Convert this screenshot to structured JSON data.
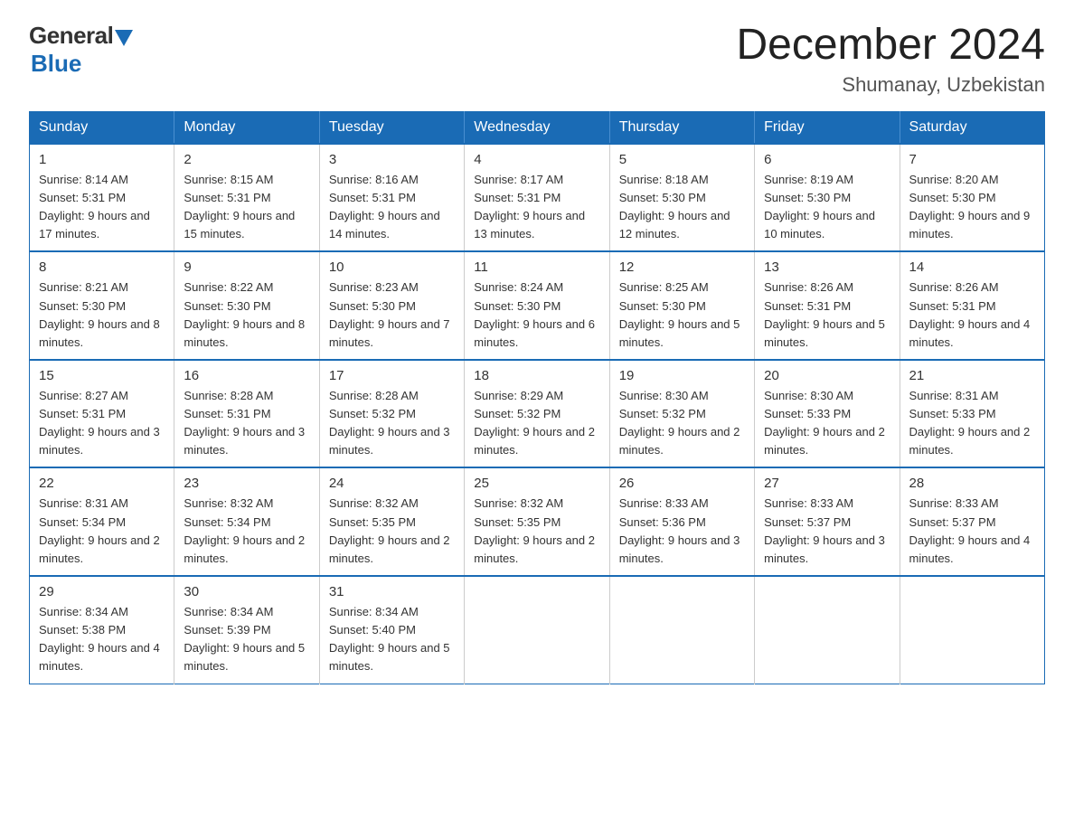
{
  "logo": {
    "text_general": "General",
    "text_blue": "Blue"
  },
  "header": {
    "month_year": "December 2024",
    "location": "Shumanay, Uzbekistan"
  },
  "days_of_week": [
    "Sunday",
    "Monday",
    "Tuesday",
    "Wednesday",
    "Thursday",
    "Friday",
    "Saturday"
  ],
  "weeks": [
    [
      {
        "day": "1",
        "sunrise": "8:14 AM",
        "sunset": "5:31 PM",
        "daylight": "9 hours and 17 minutes."
      },
      {
        "day": "2",
        "sunrise": "8:15 AM",
        "sunset": "5:31 PM",
        "daylight": "9 hours and 15 minutes."
      },
      {
        "day": "3",
        "sunrise": "8:16 AM",
        "sunset": "5:31 PM",
        "daylight": "9 hours and 14 minutes."
      },
      {
        "day": "4",
        "sunrise": "8:17 AM",
        "sunset": "5:31 PM",
        "daylight": "9 hours and 13 minutes."
      },
      {
        "day": "5",
        "sunrise": "8:18 AM",
        "sunset": "5:30 PM",
        "daylight": "9 hours and 12 minutes."
      },
      {
        "day": "6",
        "sunrise": "8:19 AM",
        "sunset": "5:30 PM",
        "daylight": "9 hours and 10 minutes."
      },
      {
        "day": "7",
        "sunrise": "8:20 AM",
        "sunset": "5:30 PM",
        "daylight": "9 hours and 9 minutes."
      }
    ],
    [
      {
        "day": "8",
        "sunrise": "8:21 AM",
        "sunset": "5:30 PM",
        "daylight": "9 hours and 8 minutes."
      },
      {
        "day": "9",
        "sunrise": "8:22 AM",
        "sunset": "5:30 PM",
        "daylight": "9 hours and 8 minutes."
      },
      {
        "day": "10",
        "sunrise": "8:23 AM",
        "sunset": "5:30 PM",
        "daylight": "9 hours and 7 minutes."
      },
      {
        "day": "11",
        "sunrise": "8:24 AM",
        "sunset": "5:30 PM",
        "daylight": "9 hours and 6 minutes."
      },
      {
        "day": "12",
        "sunrise": "8:25 AM",
        "sunset": "5:30 PM",
        "daylight": "9 hours and 5 minutes."
      },
      {
        "day": "13",
        "sunrise": "8:26 AM",
        "sunset": "5:31 PM",
        "daylight": "9 hours and 5 minutes."
      },
      {
        "day": "14",
        "sunrise": "8:26 AM",
        "sunset": "5:31 PM",
        "daylight": "9 hours and 4 minutes."
      }
    ],
    [
      {
        "day": "15",
        "sunrise": "8:27 AM",
        "sunset": "5:31 PM",
        "daylight": "9 hours and 3 minutes."
      },
      {
        "day": "16",
        "sunrise": "8:28 AM",
        "sunset": "5:31 PM",
        "daylight": "9 hours and 3 minutes."
      },
      {
        "day": "17",
        "sunrise": "8:28 AM",
        "sunset": "5:32 PM",
        "daylight": "9 hours and 3 minutes."
      },
      {
        "day": "18",
        "sunrise": "8:29 AM",
        "sunset": "5:32 PM",
        "daylight": "9 hours and 2 minutes."
      },
      {
        "day": "19",
        "sunrise": "8:30 AM",
        "sunset": "5:32 PM",
        "daylight": "9 hours and 2 minutes."
      },
      {
        "day": "20",
        "sunrise": "8:30 AM",
        "sunset": "5:33 PM",
        "daylight": "9 hours and 2 minutes."
      },
      {
        "day": "21",
        "sunrise": "8:31 AM",
        "sunset": "5:33 PM",
        "daylight": "9 hours and 2 minutes."
      }
    ],
    [
      {
        "day": "22",
        "sunrise": "8:31 AM",
        "sunset": "5:34 PM",
        "daylight": "9 hours and 2 minutes."
      },
      {
        "day": "23",
        "sunrise": "8:32 AM",
        "sunset": "5:34 PM",
        "daylight": "9 hours and 2 minutes."
      },
      {
        "day": "24",
        "sunrise": "8:32 AM",
        "sunset": "5:35 PM",
        "daylight": "9 hours and 2 minutes."
      },
      {
        "day": "25",
        "sunrise": "8:32 AM",
        "sunset": "5:35 PM",
        "daylight": "9 hours and 2 minutes."
      },
      {
        "day": "26",
        "sunrise": "8:33 AM",
        "sunset": "5:36 PM",
        "daylight": "9 hours and 3 minutes."
      },
      {
        "day": "27",
        "sunrise": "8:33 AM",
        "sunset": "5:37 PM",
        "daylight": "9 hours and 3 minutes."
      },
      {
        "day": "28",
        "sunrise": "8:33 AM",
        "sunset": "5:37 PM",
        "daylight": "9 hours and 4 minutes."
      }
    ],
    [
      {
        "day": "29",
        "sunrise": "8:34 AM",
        "sunset": "5:38 PM",
        "daylight": "9 hours and 4 minutes."
      },
      {
        "day": "30",
        "sunrise": "8:34 AM",
        "sunset": "5:39 PM",
        "daylight": "9 hours and 5 minutes."
      },
      {
        "day": "31",
        "sunrise": "8:34 AM",
        "sunset": "5:40 PM",
        "daylight": "9 hours and 5 minutes."
      },
      null,
      null,
      null,
      null
    ]
  ]
}
